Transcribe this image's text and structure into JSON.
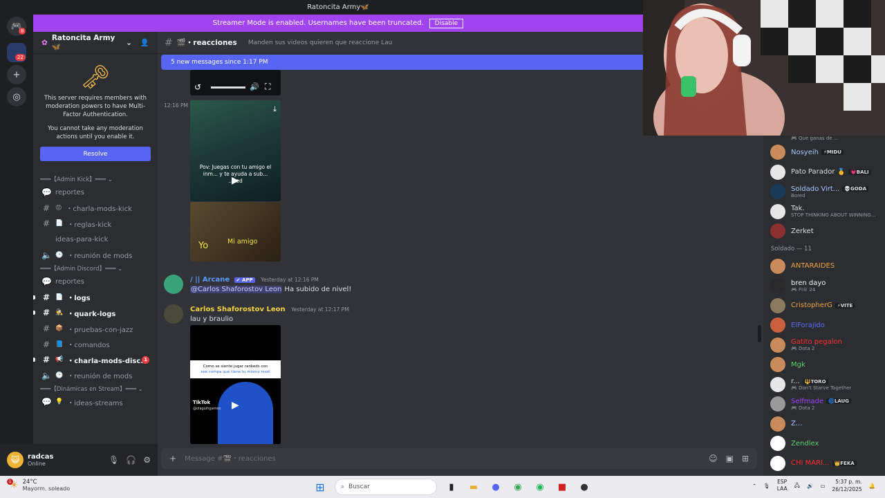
{
  "window": {
    "title": "Ratoncita Army🦋"
  },
  "streamer_banner": {
    "text": "Streamer Mode is enabled. Usernames have been truncated.",
    "button": "Disable"
  },
  "rail": {
    "dm_badge": "8",
    "server_badge": "22"
  },
  "server": {
    "name": "Ratoncita Army🦋"
  },
  "mfa": {
    "line1": "This server requires members with moderation powers to have Multi-Factor Authentication.",
    "line2": "You cannot take any moderation actions until you enable it.",
    "button": "Resolve"
  },
  "channels": [
    {
      "type": "cat",
      "label": "═══【Admin Kick】═══ ⌄"
    },
    {
      "type": "forum",
      "label": "reportes"
    },
    {
      "type": "text",
      "emoji": "😡",
      "label": "・charla-mods-kick"
    },
    {
      "type": "text",
      "emoji": "📄",
      "label": "・reglas-kick"
    },
    {
      "type": "plain",
      "label": "ideas-para-kick"
    },
    {
      "type": "voice",
      "emoji": "🕒",
      "label": "・reunión de mods"
    },
    {
      "type": "cat",
      "label": "═══【Admin Discord】═══ ⌄"
    },
    {
      "type": "forum",
      "label": "reportes"
    },
    {
      "type": "text",
      "emoji": "📄",
      "label": "・logs",
      "unread": true
    },
    {
      "type": "text",
      "emoji": "🕵️",
      "label": "・quark-logs",
      "unread": true
    },
    {
      "type": "text",
      "emoji": "📦",
      "label": "・pruebas-con-jazz"
    },
    {
      "type": "text",
      "emoji": "📘",
      "label": "・comandos"
    },
    {
      "type": "text",
      "emoji": "📢",
      "label": "・charla-mods-disc...",
      "unread": true,
      "badge": "1"
    },
    {
      "type": "voice",
      "emoji": "🕒",
      "label": "・reunión de mods"
    },
    {
      "type": "cat",
      "label": "═══【Dinámicas en Stream】═══ ⌄"
    },
    {
      "type": "forum",
      "emoji": "💡",
      "label": "・ideas-streams"
    }
  ],
  "user": {
    "name": "radcas",
    "status": "Online"
  },
  "channel": {
    "name": "🎬・reacciones",
    "topic": "Manden sus videos quieren que reaccione Lau"
  },
  "new_messages": "5 new messages since 1:17 PM",
  "messages": {
    "video_time": "12:16 PM",
    "video_caption": "Pov: Juegas con tu amigo el inm... y te ayuda a sub... ...ked",
    "meme_left": "Yo",
    "meme_right": "Mi amigo",
    "arcane": {
      "author": "/ || Arcane",
      "tag": "✔ APP",
      "time": "Yesterday at 12:16 PM",
      "mention": "@Carlos Shaforostov Leon",
      "text": " Ha subido de nivel!"
    },
    "carlos": {
      "author": "Carlos Shaforostov Leon",
      "time": "Yesterday at 12:17 PM",
      "text": "lau y braulio"
    },
    "tiktok_caption1": "Como se siente jugar rankeds con",
    "tiktok_caption2": "ese compa que tiene tu mismo nivel",
    "tiktok_brand": "TikTok",
    "tiktok_handle": "@olaguihgames"
  },
  "composer": {
    "placeholder": "Message #🎬・reacciones"
  },
  "members_top_sub": "🎮 Que ganas de ...",
  "members": [
    {
      "name": "Nosyeih",
      "tag": "⚡MIDU",
      "color": "#a8c8ff",
      "avatar": "#c98b5b"
    },
    {
      "name": "Pato Parador 🥇",
      "tag": "💗BALI",
      "color": "#dbdee1",
      "avatar": "#e6e6e6"
    },
    {
      "name": "Soldado Virt...",
      "tag": "💀GODA",
      "sub": "Bored",
      "color": "#a8c8ff",
      "avatar": "#1a3a5a"
    },
    {
      "name": "Tak.",
      "sub": "STOP THINKING ABOUT WINNING...",
      "color": "#dbdee1",
      "avatar": "#e6e6e6"
    },
    {
      "name": "Zerket",
      "color": "#dbdee1",
      "avatar": "#8a3030"
    }
  ],
  "members_section": "Soldado — 11",
  "members2": [
    {
      "name": "ANTARAIDES",
      "color": "#f0a040",
      "avatar": "#c98b5b"
    },
    {
      "name": "bren dayo",
      "sub": "🎮 FI® 24",
      "color": "#f2f3f5",
      "avatar": "#2a2a2a"
    },
    {
      "name": "CristopherG",
      "tag": "⚡VITE",
      "color": "#f0a040",
      "avatar": "#8a7a60"
    },
    {
      "name": "ElForajido",
      "color": "#5b6cff",
      "avatar": "#c86040"
    },
    {
      "name": "Gatito pegalon",
      "sub": "🎮 Dota 2",
      "color": "#ff3030",
      "avatar": "#c98b5b"
    },
    {
      "name": "Mgk",
      "color": "#5dd16e",
      "avatar": "#c98b5b"
    },
    {
      "name": "r...",
      "tag": "🔱TORO",
      "sub": "🎮 Don't Starve Together",
      "color": "#dbdee1",
      "avatar": "#e6e6e6"
    },
    {
      "name": "Selfmade",
      "tag": "🌀LAUG",
      "sub": "🎮 Dota 2",
      "color": "#a040ff",
      "avatar": "#9a9a9a"
    },
    {
      "name": "Z...",
      "color": "#a8c8ff",
      "avatar": "#c98b5b"
    },
    {
      "name": "Zendlex",
      "color": "#5dd16e",
      "avatar": "#ffffff"
    },
    {
      "name": "CHI MARI...",
      "tag": "👑FEKA",
      "color": "#ff3030",
      "avatar": "#ffffff"
    }
  ],
  "taskbar": {
    "temp": "24°C",
    "weather": "Mayorm. soleado",
    "weather_badge": "1",
    "search": "Buscar",
    "lang1": "ESP",
    "lang2": "LAA",
    "time": "5:37 p. m.",
    "date": "26/12/2025"
  }
}
